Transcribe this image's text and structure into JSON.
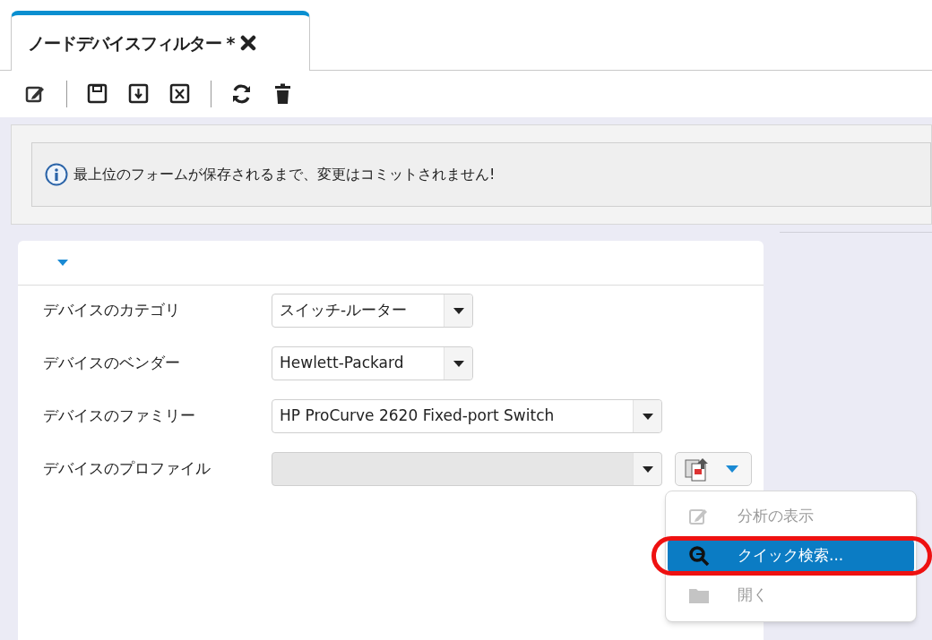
{
  "tab": {
    "title": "ノードデバイスフィルター *",
    "selected": true
  },
  "toolbar": [
    {
      "kind": "edit"
    },
    {
      "kind": "separator"
    },
    {
      "kind": "save"
    },
    {
      "kind": "save-down"
    },
    {
      "kind": "save-cross"
    },
    {
      "kind": "separator"
    },
    {
      "kind": "refresh"
    },
    {
      "kind": "delete"
    }
  ],
  "notice": {
    "text": "最上位のフォームが保存されるまで、変更はコミットされません!"
  },
  "form": {
    "fields": [
      {
        "label": "デバイスのカテゴリ",
        "value": "スイッチ-ルーター",
        "disabled": false
      },
      {
        "label": "デバイスのベンダー",
        "value": "Hewlett-Packard",
        "disabled": false
      },
      {
        "label": "デバイスのファミリー",
        "value": "HP ProCurve 2620 Fixed-port Switch",
        "disabled": false
      },
      {
        "label": "デバイスのプロファイル",
        "disabled": true,
        "has_actions": true
      }
    ]
  },
  "menu": {
    "items": [
      {
        "label": "分析の表示",
        "disabled": true,
        "selected": false,
        "highlighted": false
      },
      {
        "label": "クイック検索...",
        "disabled": false,
        "selected": true,
        "highlighted": true
      },
      {
        "label": "開く",
        "disabled": true,
        "selected": false,
        "highlighted": false
      }
    ]
  }
}
